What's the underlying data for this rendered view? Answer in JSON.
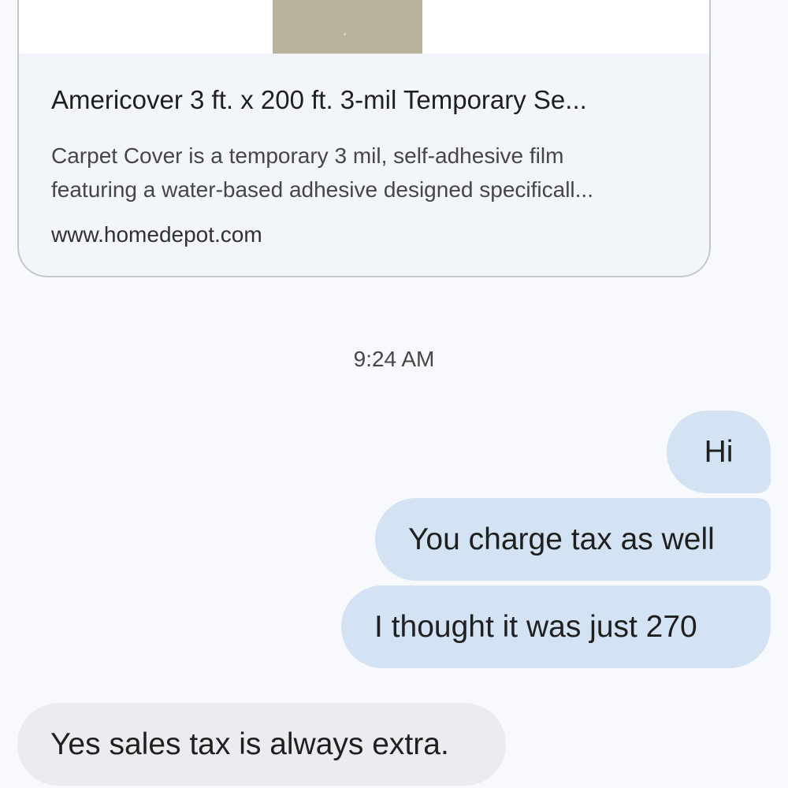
{
  "link_preview": {
    "title": "Americover 3 ft. x 200 ft. 3-mil Temporary Se...",
    "description_lines": [
      "Carpet Cover is a temporary 3 mil, self-adhesive film",
      "featuring a water-based adhesive designed specificall..."
    ],
    "url": "www.homedepot.com"
  },
  "timestamp": "9:24 AM",
  "outgoing_messages": [
    "Hi",
    "You charge tax as well",
    "I thought it was just 270"
  ],
  "incoming_messages": [
    "Yes sales tax is always extra."
  ],
  "colors": {
    "background": "#f8f9fc",
    "outgoing_bubble": "#d3e3f3",
    "incoming_bubble": "#ebecef",
    "card_background": "#f2f6fa"
  }
}
